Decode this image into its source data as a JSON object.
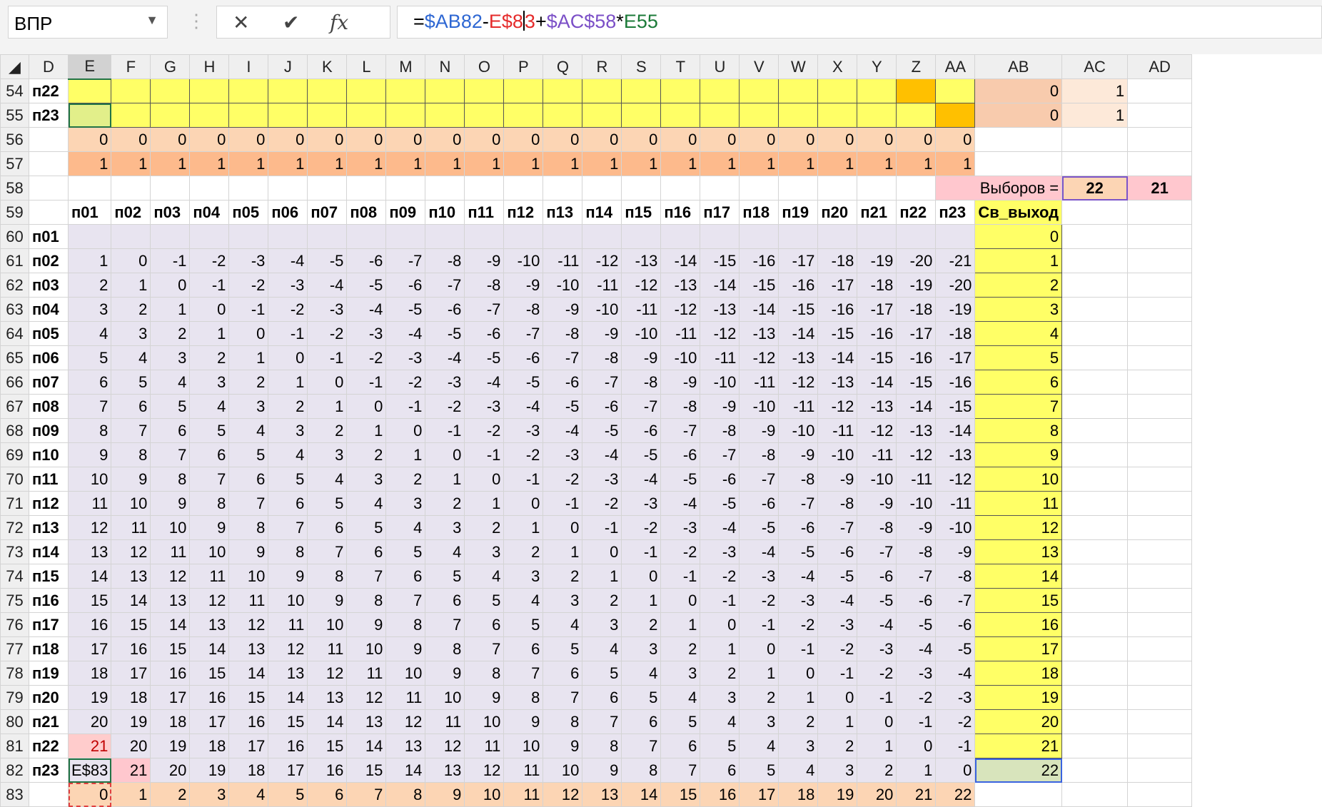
{
  "name_box": "ВПР",
  "formula": {
    "eq": "=",
    "p1": "$AB82",
    "op1": "-",
    "p2": "E$8",
    "p2b": "3",
    "op2": "+",
    "p3": "$AC$58",
    "op3": "*",
    "p4": "E55"
  },
  "col_headers": [
    "D",
    "E",
    "F",
    "G",
    "H",
    "I",
    "J",
    "K",
    "L",
    "M",
    "N",
    "O",
    "P",
    "Q",
    "R",
    "S",
    "T",
    "U",
    "V",
    "W",
    "X",
    "Y",
    "Z",
    "AA",
    "AB",
    "AC",
    "AD"
  ],
  "row_54": {
    "num": "54",
    "label": "п22",
    "ab": "0",
    "ac": "1"
  },
  "row_55": {
    "num": "55",
    "label": "п23",
    "ab": "0",
    "ac": "1"
  },
  "row_56": {
    "num": "56",
    "value": "0"
  },
  "row_57": {
    "num": "57",
    "value": "1"
  },
  "row_58": {
    "num": "58",
    "label": "Выборов =",
    "ac": "22",
    "ad": "21"
  },
  "header_row": {
    "num": "59",
    "last": "Св_выход"
  },
  "names": [
    "п01",
    "п02",
    "п03",
    "п04",
    "п05",
    "п06",
    "п07",
    "п08",
    "п09",
    "п10",
    "п11",
    "п12",
    "п13",
    "п14",
    "п15",
    "п16",
    "п17",
    "п18",
    "п19",
    "п20",
    "п21",
    "п22",
    "п23"
  ],
  "e82_text": "E$83",
  "row_83": {
    "num": "83"
  }
}
